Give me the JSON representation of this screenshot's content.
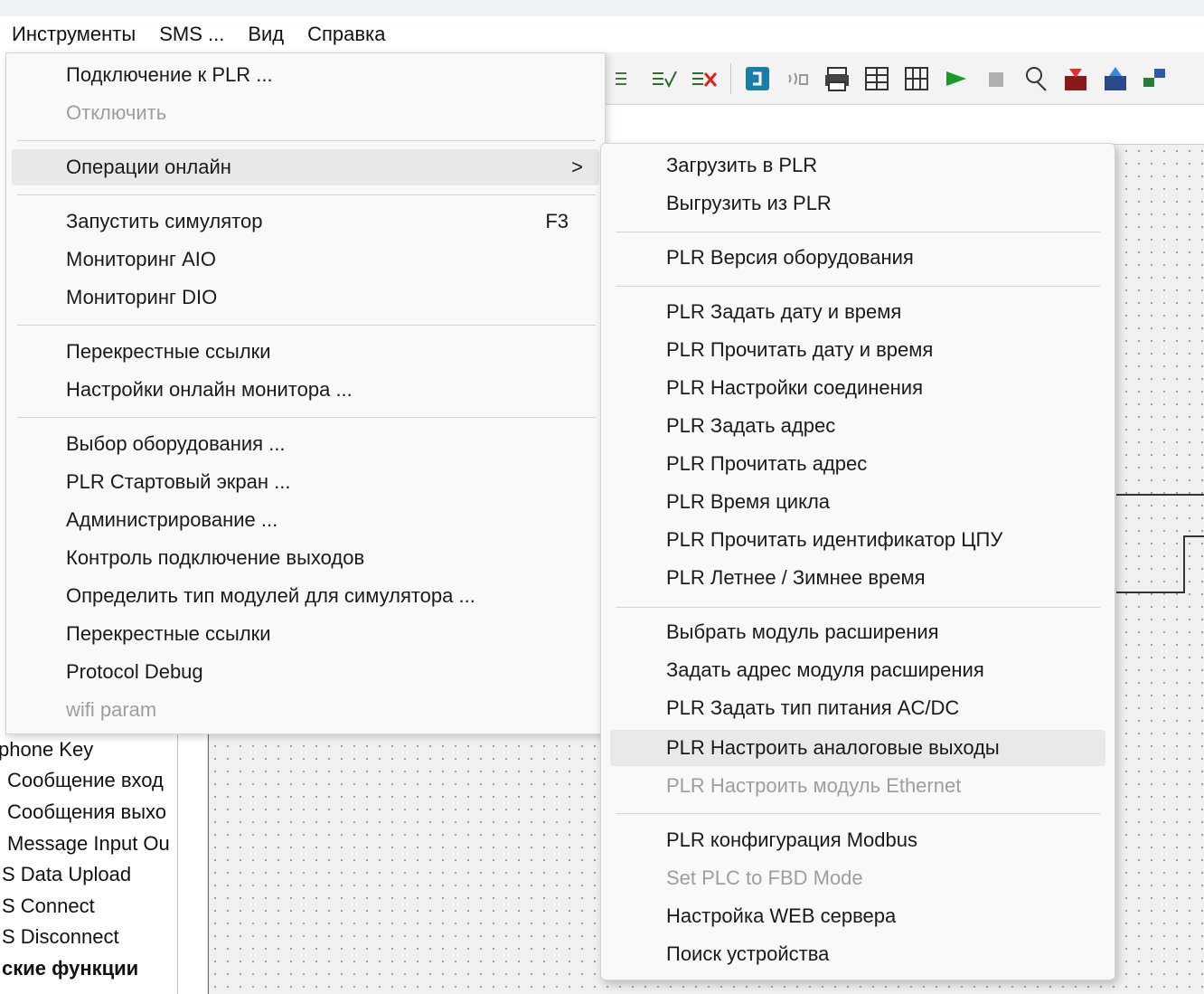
{
  "menubar": [
    "Инструменты",
    "SMS ...",
    "Вид",
    "Справка"
  ],
  "tools_menu": {
    "connect": "Подключение к PLR ...",
    "disconnect": "Отключить",
    "online_ops": "Операции онлайн",
    "online_ops_arrow": ">",
    "run_sim": "Запустить симулятор",
    "run_sim_key": "F3",
    "mon_aio": "Мониторинг AIO",
    "mon_dio": "Мониторинг DIO",
    "xref1": "Перекрестные ссылки",
    "monitor_settings": "Настройки онлайн монитора ...",
    "hw_select": "Выбор оборудования ...",
    "start_screen": "PLR Стартовый экран ...",
    "admin": "Администрирование ...",
    "out_control": "Контроль подключение выходов",
    "sim_modules": "Определить тип модулей для симулятора ...",
    "xref2": "Перекрестные ссылки",
    "protocol_debug": "Protocol Debug",
    "wifi": "wifi param"
  },
  "online_submenu": {
    "upload_to": "Загрузить в PLR",
    "download_from": "Выгрузить из PLR",
    "hw_version": "PLR Версия оборудования",
    "set_datetime": "PLR Задать дату и время",
    "read_datetime": "PLR Прочитать дату и время",
    "conn_settings": "PLR Настройки соединения",
    "set_address": "PLR Задать адрес",
    "read_address": "PLR Прочитать адрес",
    "cycle_time": "PLR Время цикла",
    "cpu_id": "PLR Прочитать идентификатор ЦПУ",
    "dst": "PLR Летнее / Зимнее время",
    "ext_module": "Выбрать модуль расширения",
    "ext_address": "Задать адрес модуля расширения",
    "power_type": "PLR Задать тип питания AC/DC",
    "analog_out": "PLR Настроить аналоговые выходы",
    "ethernet": "PLR Настроить модуль Ethernet",
    "modbus": "PLR конфигурация Modbus",
    "fbd_mode": "Set PLC to FBD Mode",
    "web_server": "Настройка WEB сервера",
    "find_device": "Поиск устройства"
  },
  "tree": [
    "phone Key",
    "Сообщение вход",
    "Сообщения выхо",
    "Message Input Ou",
    "S Data Upload",
    "S Connect",
    "S Disconnect",
    "ские функции"
  ],
  "toolbar_icons": [
    "compile-check-icon",
    "verify-icon",
    "delete-verify-icon",
    "connect-icon",
    "wireless-icon",
    "print-icon",
    "grid-icon",
    "table-icon",
    "run-icon",
    "stop-icon",
    "probe-icon",
    "download-icon",
    "upload-icon",
    "network-icon"
  ],
  "colors": {
    "menu_bg": "#f9f9f9",
    "highlight": "#e8e8e8",
    "disabled": "#9e9e9e",
    "run_green": "#1a9a2a"
  }
}
